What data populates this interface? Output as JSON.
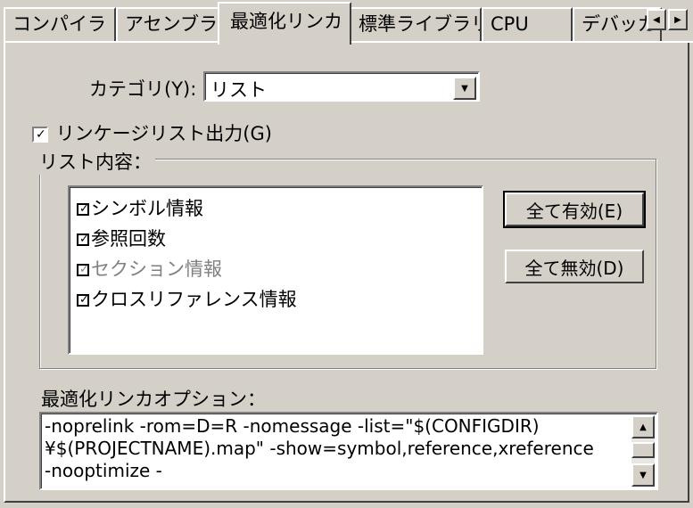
{
  "tabs": [
    {
      "label": "コンパイラ"
    },
    {
      "label": "アセンブラ"
    },
    {
      "label": "最適化リンカ"
    },
    {
      "label": "標準ライブラリ"
    },
    {
      "label": "CPU"
    },
    {
      "label": "デバッガ"
    }
  ],
  "category": {
    "label": "カテゴリ(Y):",
    "value": "リスト"
  },
  "linkage_list": {
    "label": "リンケージリスト出力(G)",
    "checked": true
  },
  "group": {
    "title": "リスト内容：",
    "items": [
      {
        "label": "シンボル情報",
        "checked": true,
        "disabled": false
      },
      {
        "label": "参照回数",
        "checked": true,
        "disabled": false
      },
      {
        "label": "セクション情報",
        "checked": true,
        "disabled": true
      },
      {
        "label": "クロスリファレンス情報",
        "checked": true,
        "disabled": false
      }
    ],
    "enable_all": "全て有効(E)",
    "disable_all": "全て無効(D)"
  },
  "options": {
    "label": "最適化リンカオプション：",
    "text": "-noprelink -rom=D=R -nomessage -list=\"$(CONFIGDIR)\n¥$(PROJECTNAME).map\" -show=symbol,reference,xreference\n-nooptimize -"
  }
}
